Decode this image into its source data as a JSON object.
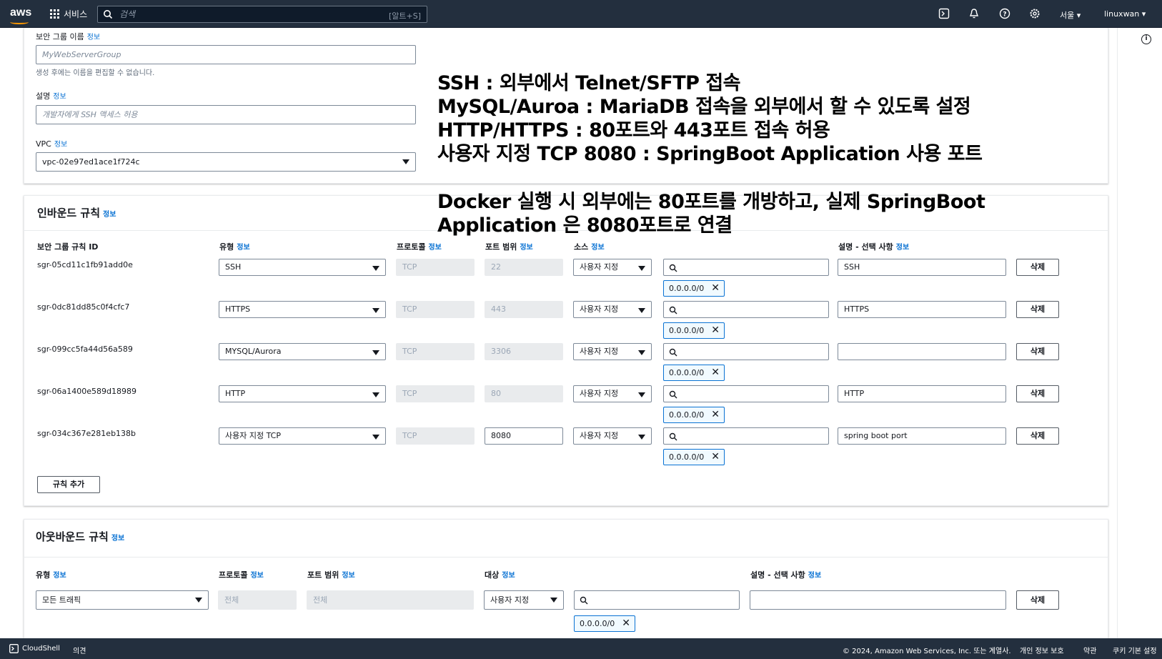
{
  "topbar": {
    "logo": "aws",
    "services": "서비스",
    "search_placeholder": "검색",
    "search_shortcut": "[알트+S]",
    "region": "서울 ▾",
    "user": "linuxwan ▾",
    "icons": [
      "cloudshell-icon",
      "bell-icon",
      "help-icon",
      "settings-icon"
    ]
  },
  "basic": {
    "name_label": "보안 그룹 이름",
    "name_info": "정보",
    "name_placeholder": "MyWebServerGroup",
    "name_hint": "생성 후에는 이름을 편집할 수 없습니다.",
    "desc_label": "설명",
    "desc_info": "정보",
    "desc_placeholder": "개발자에게 SSH 액세스 허용",
    "vpc_label": "VPC",
    "vpc_info": "정보",
    "vpc_value": "vpc-02e97ed1ace1f724c"
  },
  "annotation": {
    "lines": [
      "SSH : 외부에서 Telnet/SFTP 접속",
      "MySQL/Auroa : MariaDB 접속을 외부에서 할 수 있도록 설정",
      "HTTP/HTTPS : 80포트와 443포트 접속 허용",
      "사용자 지정 TCP 8080 : SpringBoot Application 사용 포트",
      "Docker 실행 시 외부에는 80포트를 개방하고, 실제 SpringBoot",
      "Application  은 8080포트로 연결"
    ]
  },
  "inbound": {
    "title": "인바운드 규칙",
    "info": "정보",
    "headers": {
      "id": "보안 그룹 규칙 ID",
      "type": "유형",
      "protocol": "프로토콜",
      "port": "포트 범위",
      "source": "소스",
      "desc": "설명 - 선택 사항",
      "info": "정보"
    },
    "rules": [
      {
        "id": "sgr-05cd11c1fb91add0e",
        "type": "SSH",
        "protocol": "TCP",
        "port": "22",
        "source": "사용자 지정",
        "cidr": "0.0.0.0/0",
        "desc": "SSH"
      },
      {
        "id": "sgr-0dc81dd85c0f4cfc7",
        "type": "HTTPS",
        "protocol": "TCP",
        "port": "443",
        "source": "사용자 지정",
        "cidr": "0.0.0.0/0",
        "desc": "HTTPS"
      },
      {
        "id": "sgr-099cc5fa44d56a589",
        "type": "MYSQL/Aurora",
        "protocol": "TCP",
        "port": "3306",
        "source": "사용자 지정",
        "cidr": "0.0.0.0/0",
        "desc": ""
      },
      {
        "id": "sgr-06a1400e589d18989",
        "type": "HTTP",
        "protocol": "TCP",
        "port": "80",
        "source": "사용자 지정",
        "cidr": "0.0.0.0/0",
        "desc": "HTTP"
      },
      {
        "id": "sgr-034c367e281eb138b",
        "type": "사용자 지정 TCP",
        "protocol": "TCP",
        "port": "8080",
        "source": "사용자 지정",
        "cidr": "0.0.0.0/0",
        "desc": "spring boot port"
      }
    ],
    "delete_label": "삭제",
    "add_rule": "규칙 추가"
  },
  "outbound": {
    "title": "아웃바운드 규칙",
    "info": "정보",
    "headers": {
      "type": "유형",
      "protocol": "프로토콜",
      "port": "포트 범위",
      "dest": "대상",
      "desc": "설명 - 선택 사항",
      "info": "정보"
    },
    "rule": {
      "type": "모든 트래픽",
      "protocol": "전체",
      "port": "전체",
      "dest": "사용자 지정",
      "cidr": "0.0.0.0/0",
      "desc": ""
    },
    "delete_label": "삭제"
  },
  "footer": {
    "cloudshell": "CloudShell",
    "feedback": "의견",
    "copyright": "© 2024, Amazon Web Services, Inc. 또는 계열사.",
    "privacy": "개인 정보 보호",
    "terms": "약관",
    "cookie": "쿠키 기본 설정"
  }
}
